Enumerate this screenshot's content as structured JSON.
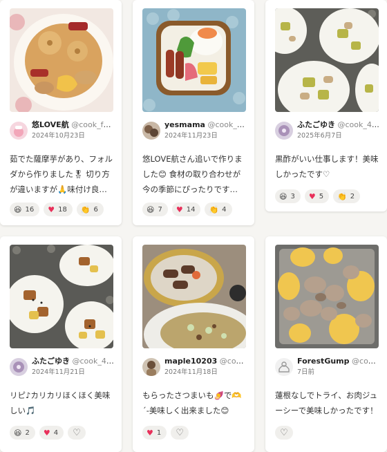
{
  "cards": [
    {
      "author": "悠LOVE航",
      "handle": "@cook_fo…",
      "date": "2024年10月23日",
      "comment": "茹でた薩摩芋があり、フォルダから作りました🎖 切り方が違いますが🙏味付け良く、と…",
      "reactions": [
        {
          "icon": "grin-icon",
          "glyph": "😆",
          "count": "16"
        },
        {
          "icon": "heart-icon",
          "glyph": "♥",
          "count": "18"
        },
        {
          "icon": "clap-icon",
          "glyph": "👏",
          "count": "6"
        }
      ]
    },
    {
      "author": "yesmama",
      "handle": "@cook_4…",
      "date": "2024年11月23日",
      "comment": "悠LOVE航さん追いで作りました😊 食材の取り合わせが今の季節にぴったりです💕オ…",
      "reactions": [
        {
          "icon": "grin-icon",
          "glyph": "😆",
          "count": "7"
        },
        {
          "icon": "heart-icon",
          "glyph": "♥",
          "count": "14"
        },
        {
          "icon": "clap-icon",
          "glyph": "👏",
          "count": "4"
        }
      ]
    },
    {
      "author": "ふたごゆき",
      "handle": "@cook_40…",
      "date": "2025年6月7日",
      "comment": "黒酢がいい仕事します！美味しかったです♡",
      "reactions": [
        {
          "icon": "grin-icon",
          "glyph": "😆",
          "count": "3"
        },
        {
          "icon": "heart-icon",
          "glyph": "♥",
          "count": "5"
        },
        {
          "icon": "clap-icon",
          "glyph": "👏",
          "count": "2"
        }
      ]
    },
    {
      "author": "ふたごゆき",
      "handle": "@cook_40…",
      "date": "2024年11月21日",
      "comment": "リピ♪カリカリほくほく美味しい🎵",
      "reactions": [
        {
          "icon": "grin-icon",
          "glyph": "😆",
          "count": "2"
        },
        {
          "icon": "heart-icon",
          "glyph": "♥",
          "count": "4"
        }
      ]
    },
    {
      "author": "maple10203",
      "handle": "@cook…",
      "date": "2024年11月18日",
      "comment": "もらったさつまいも🍠で🫶´-美味しく出来ました😊",
      "reactions": [
        {
          "icon": "heart-icon",
          "glyph": "♥",
          "count": "1"
        }
      ]
    },
    {
      "author": "ForestGump",
      "handle": "@cook…",
      "date": "7日前",
      "comment": "蓮根なしでトライ、お肉ジューシーで美味しかったです！",
      "reactions": []
    }
  ],
  "colors": {
    "heart": "#e8305a",
    "pill_bg": "#f0efec"
  }
}
